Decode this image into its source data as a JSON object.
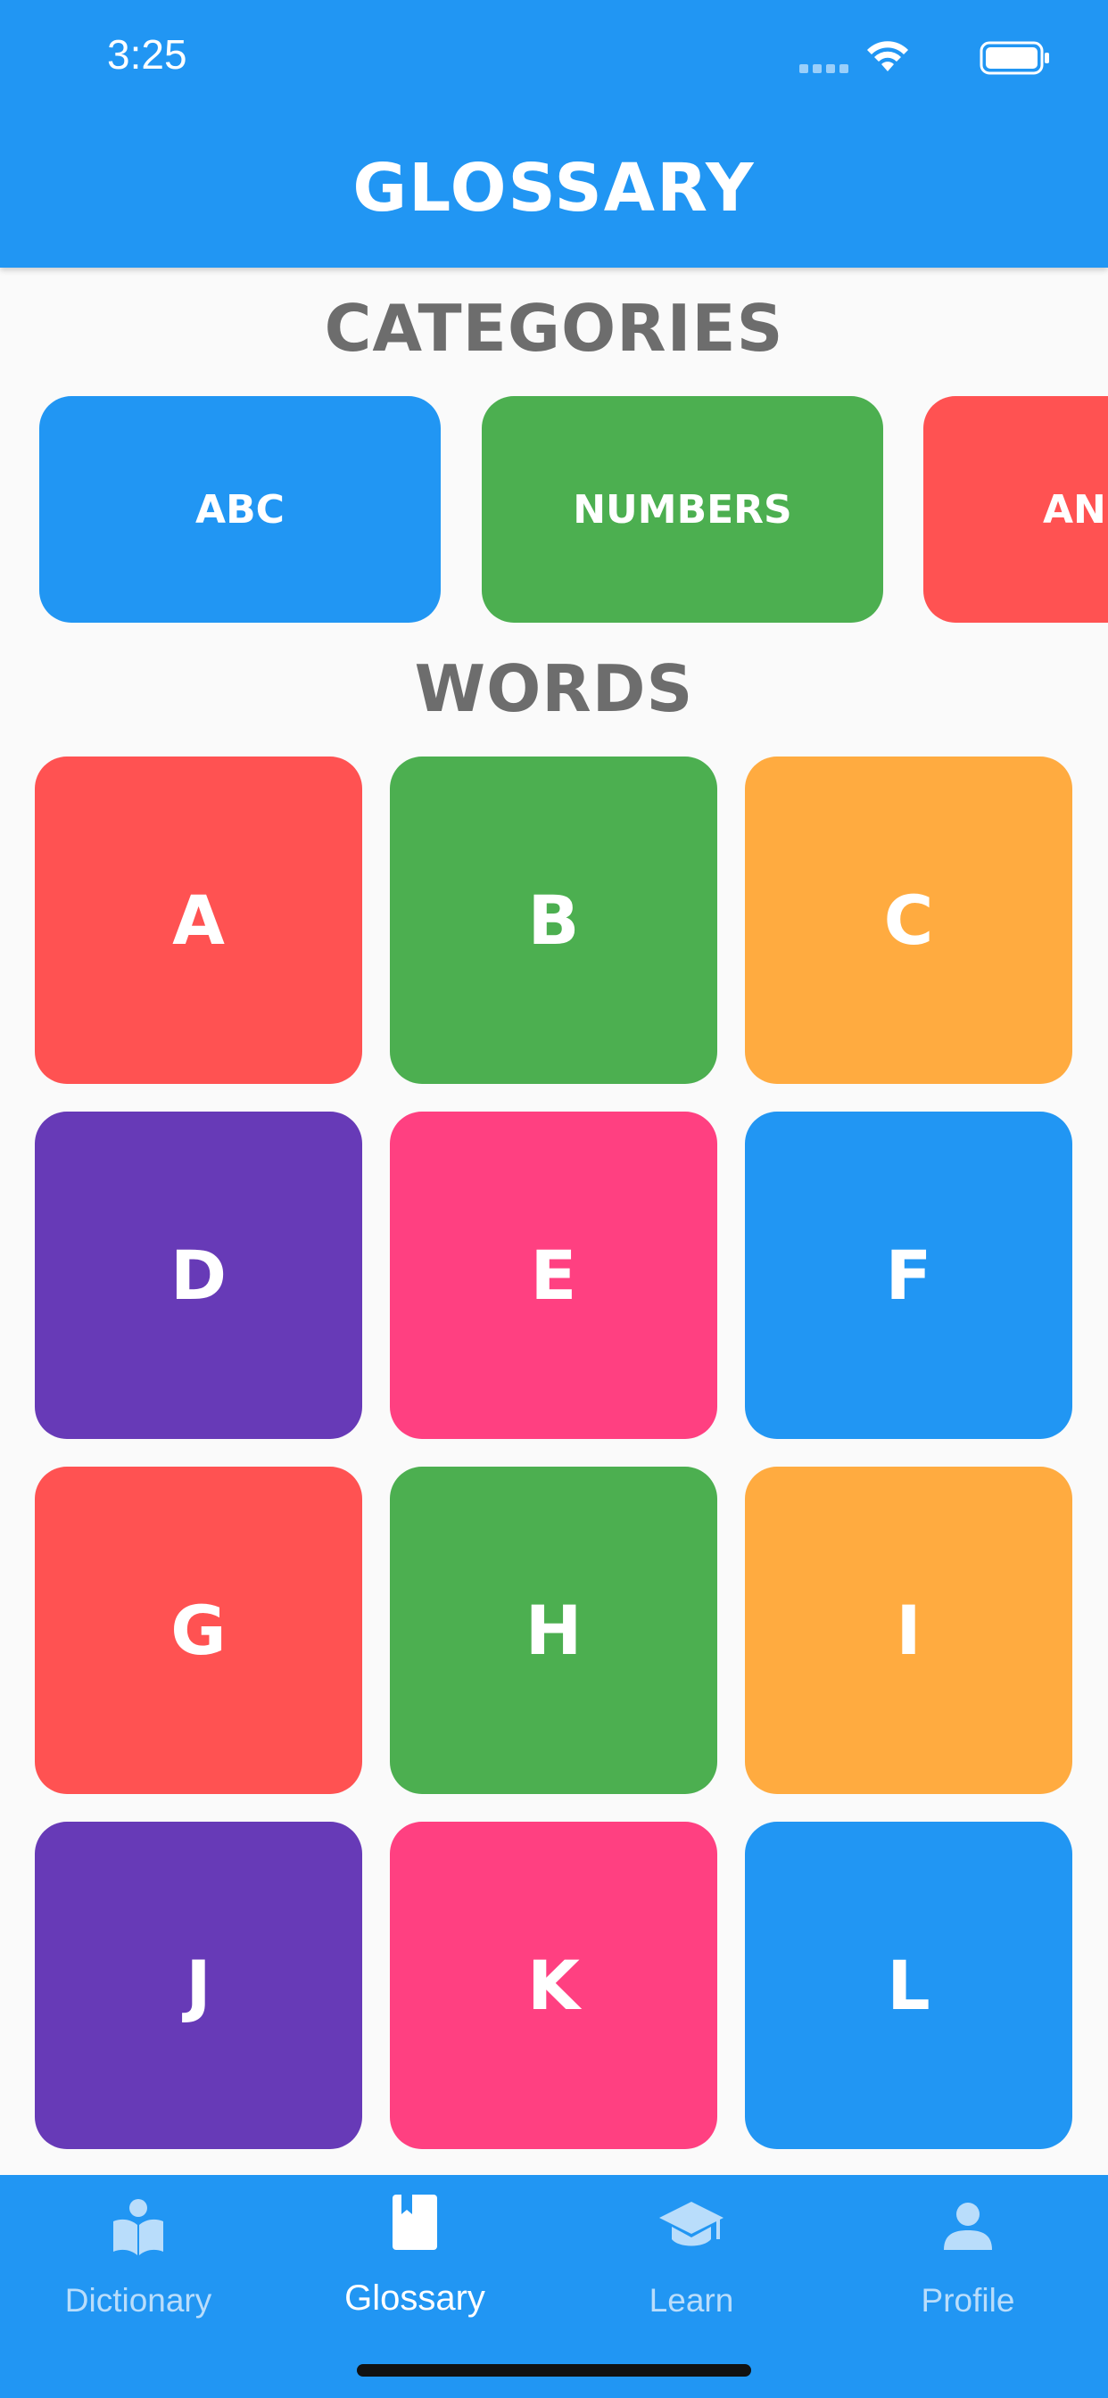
{
  "status_bar": {
    "time": "3:25",
    "icons": [
      "signal-dots-icon",
      "wifi-icon",
      "battery-icon"
    ]
  },
  "header": {
    "title": "GLOSSARY"
  },
  "categories": {
    "title": "CATEGORIES",
    "items": [
      {
        "label": "ABC",
        "color": "#2196f3"
      },
      {
        "label": "NUMBERS",
        "color": "#4caf50"
      },
      {
        "label": "ANI",
        "color": "#ff5252"
      }
    ]
  },
  "words": {
    "title": "WORDS",
    "items": [
      {
        "label": "A",
        "color": "#ff5252"
      },
      {
        "label": "B",
        "color": "#4caf50"
      },
      {
        "label": "C",
        "color": "#ffab40"
      },
      {
        "label": "D",
        "color": "#673ab7"
      },
      {
        "label": "E",
        "color": "#ff4081"
      },
      {
        "label": "F",
        "color": "#2196f3"
      },
      {
        "label": "G",
        "color": "#ff5252"
      },
      {
        "label": "H",
        "color": "#4caf50"
      },
      {
        "label": "I",
        "color": "#ffab40"
      },
      {
        "label": "J",
        "color": "#673ab7"
      },
      {
        "label": "K",
        "color": "#ff4081"
      },
      {
        "label": "L",
        "color": "#2196f3"
      }
    ]
  },
  "bottom_nav": {
    "items": [
      {
        "label": "Dictionary",
        "icon": "reading-book-icon",
        "active": false
      },
      {
        "label": "Glossary",
        "icon": "bookmark-book-icon",
        "active": true
      },
      {
        "label": "Learn",
        "icon": "graduation-cap-icon",
        "active": false
      },
      {
        "label": "Profile",
        "icon": "person-icon",
        "active": false
      }
    ]
  },
  "colors": {
    "primary": "#2196f3",
    "background": "#fafafa",
    "section_title": "#6d6d6d",
    "nav_inactive": "#b9ddfb",
    "nav_active": "#ffffff"
  }
}
